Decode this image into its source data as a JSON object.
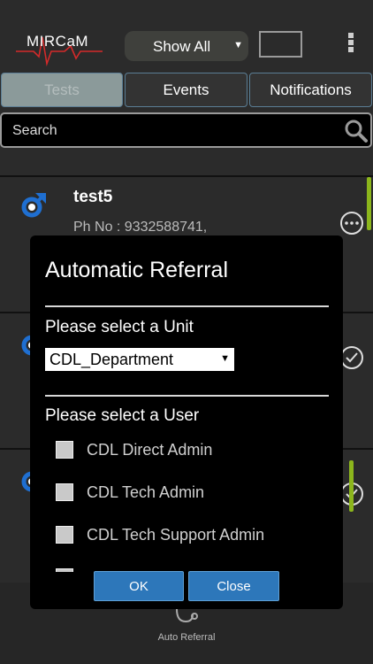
{
  "header": {
    "logo_text": "MIRCaM",
    "filter": {
      "selected": "Show All"
    }
  },
  "tabs": [
    {
      "label": "Tests",
      "active": true
    },
    {
      "label": "Events",
      "active": false
    },
    {
      "label": "Notifications",
      "active": false
    }
  ],
  "search": {
    "placeholder": "Search"
  },
  "patients": [
    {
      "name": "test5",
      "phone": "Ph No : 9332588741,",
      "gender_icon": "male-icon",
      "action_icon": "more-icon"
    },
    {
      "name": "",
      "phone": "",
      "gender_icon": "male-icon",
      "action_icon": "check-circle-icon"
    },
    {
      "name": "",
      "phone": "",
      "gender_icon": "male-icon",
      "action_icon": "check-circle-icon"
    }
  ],
  "bottom_nav": {
    "auto_referral_label": "Auto Referral"
  },
  "dialog": {
    "title": "Automatic Referral",
    "unit_label": "Please select a Unit",
    "unit_selected": "CDL_Department",
    "user_label": "Please select a User",
    "users": [
      {
        "name": "CDL Direct Admin",
        "checked": false
      },
      {
        "name": "CDL Tech Admin",
        "checked": false
      },
      {
        "name": "CDL Tech Support Admin",
        "checked": false
      }
    ],
    "ok_label": "OK",
    "close_label": "Close"
  },
  "colors": {
    "background": "#2b2b2b",
    "accent_blue": "#2d77ba",
    "scroll_green": "#8cb61c",
    "logo_red": "#d42a2a",
    "gender_blue": "#1f6fd1"
  }
}
